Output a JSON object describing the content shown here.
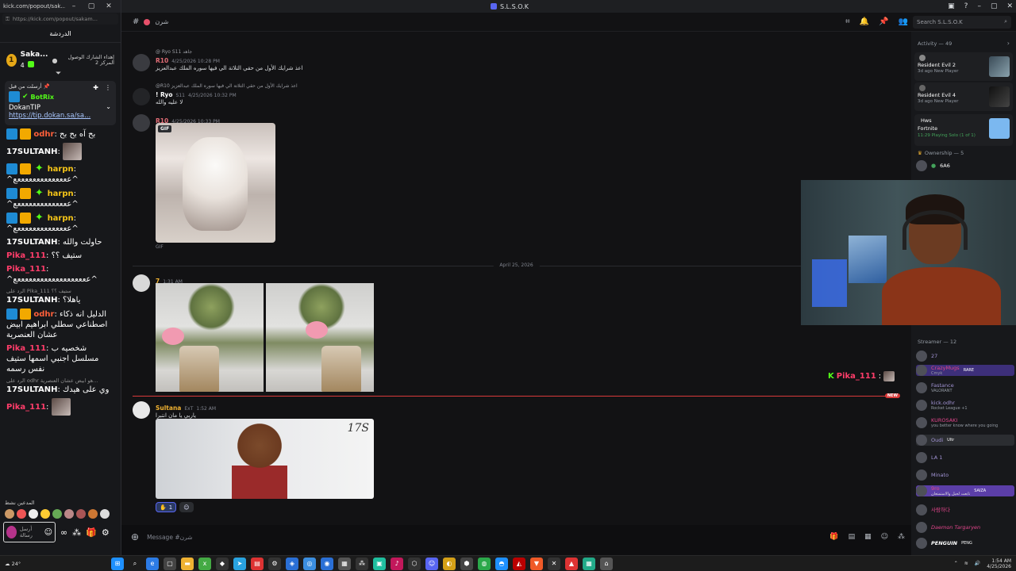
{
  "kick": {
    "window_title": "kick.com/popout/sak...",
    "url": "https://kick.com/popout/sakam...",
    "chat_header": "الدردشة",
    "gift": {
      "name": "Saka...",
      "count": "4",
      "rank": "1",
      "info": "إهداء الشارك الوصول المركز 2"
    },
    "pinned": {
      "header": "أرسلت من قبل",
      "bot": "BotRix",
      "title": "DokanTIP",
      "link": "https://tip.dokan.sa/sa..."
    },
    "messages": [
      {
        "user": "odhr",
        "text": "بح آه بح بح"
      },
      {
        "user": "17SULTANH",
        "text": ""
      },
      {
        "user": "harpn",
        "text": "^ععععععععععععععع^"
      },
      {
        "user": "harpn",
        "text": "^ععععععععععععععع^"
      },
      {
        "user": "harpn",
        "text": "^ععععععععععععععع^"
      },
      {
        "user": "17SULTANH",
        "text": "حاولت والله"
      },
      {
        "user": "Pika_111",
        "text": "ستيف ؟؟"
      },
      {
        "user": "Pika_111",
        "text": "^عععععععععععععععععععع^"
      },
      {
        "user": "17SULTANH",
        "text": "ياهلا؟"
      },
      {
        "user": "odhr",
        "text": "الدليل انه ذكاء اصطناعي سطلي ابراهيم ابيض عشان العنصرية"
      },
      {
        "user": "Pika_111",
        "text": "شخصيه ب مسلسل اجنبي اسمها ستيف نفس رسمه"
      },
      {
        "user": "17SULTANH",
        "text": "وي على هيدك"
      },
      {
        "user": "Pika_111",
        "text": ""
      }
    ],
    "reply_1": "ستيف ؟؟ Pika_111 الرد على",
    "reply_2": "...هو ابيض عشان العنصرية odhr الرد على",
    "bottom_label": "المدعين نشط",
    "input_placeholder": "أرسل رسالة"
  },
  "discord": {
    "title": "S.L.S.O.K",
    "channel": "شرن",
    "search_placeholder": "Search S.L.S.O.K",
    "messages": {
      "m1_reply": "@ Ryo  S11  جاهد",
      "m1_user": "R10",
      "m1_time": "4/25/2026 10:28 PM",
      "m1_text": "اعذ شرايك الأول من حقي التلاتة الي فيها سوره الملك عبدالعزيز",
      "m2_reply": "@R10 اعذ شرايك الأول من حقي التلاتة الي فيها سوره الملك عبدالعزيز",
      "m2_user": "! Ryo",
      "m2_tag": "S11",
      "m2_time": "4/25/2026 10:32 PM",
      "m2_text": "لا عليه والله",
      "m3_user": "R10",
      "m3_time": "4/25/2026 10:33 PM",
      "gif_tag": "GIF",
      "gif_caption": "GIF",
      "divider_date": "April 25, 2026",
      "m4_user": "7",
      "m4_time": "1:31 AM",
      "new_badge": "NEW",
      "m5_user": "Sultana",
      "m5_tag": "ExT",
      "m5_time": "1:52 AM",
      "m5_text": "ياربي يا مان انتبرا",
      "banner_sig": "17S",
      "reaction_count": "1",
      "pika_inline": "Pika_111"
    },
    "composer_placeholder": "Message #شرن",
    "members": {
      "activity_label": "Activity — 49",
      "activities": [
        {
          "game": "Resident Evil 2",
          "sub": "3d ago  New Player"
        },
        {
          "game": "Resident Evil 4",
          "sub": "3d ago  New Player"
        },
        {
          "game": "Hws",
          "game2": "Fortnite",
          "sub": "11:29  Playing Solo (1 of 1)"
        }
      ],
      "ownership_label": "Ownership — 5",
      "owner_tag": "6A6",
      "streamer_label": "Streamer — 12",
      "streamers": [
        {
          "name": "27",
          "sub": ""
        },
        {
          "name": "CrazyMugs",
          "sub": "Cmyk",
          "tag": "RARE"
        },
        {
          "name": "Fastance",
          "sub": "VALORANT"
        },
        {
          "name": "kick.odhr",
          "sub": "Rocket League +1"
        },
        {
          "name": "KUROSAKI",
          "sub": "you better know where you going",
          "tag": "LOMI"
        },
        {
          "name": "Oudi",
          "sub": "",
          "tag": "Ultr"
        },
        {
          "name": "LA 1",
          "sub": ""
        },
        {
          "name": "Minato",
          "sub": ""
        },
        {
          "name": "9ro",
          "sub": "تابعت لحيل والاستمتعان",
          "tag": "SAIZA"
        },
        {
          "name": "사람하다",
          "sub": ""
        },
        {
          "name": "Daemon Targaryen",
          "sub": ""
        },
        {
          "name": "PENGUIN",
          "sub": "",
          "tag": "PENG"
        }
      ]
    }
  },
  "taskbar": {
    "weather": "24°",
    "time": "1:54 AM",
    "date": "4/25/2026"
  }
}
